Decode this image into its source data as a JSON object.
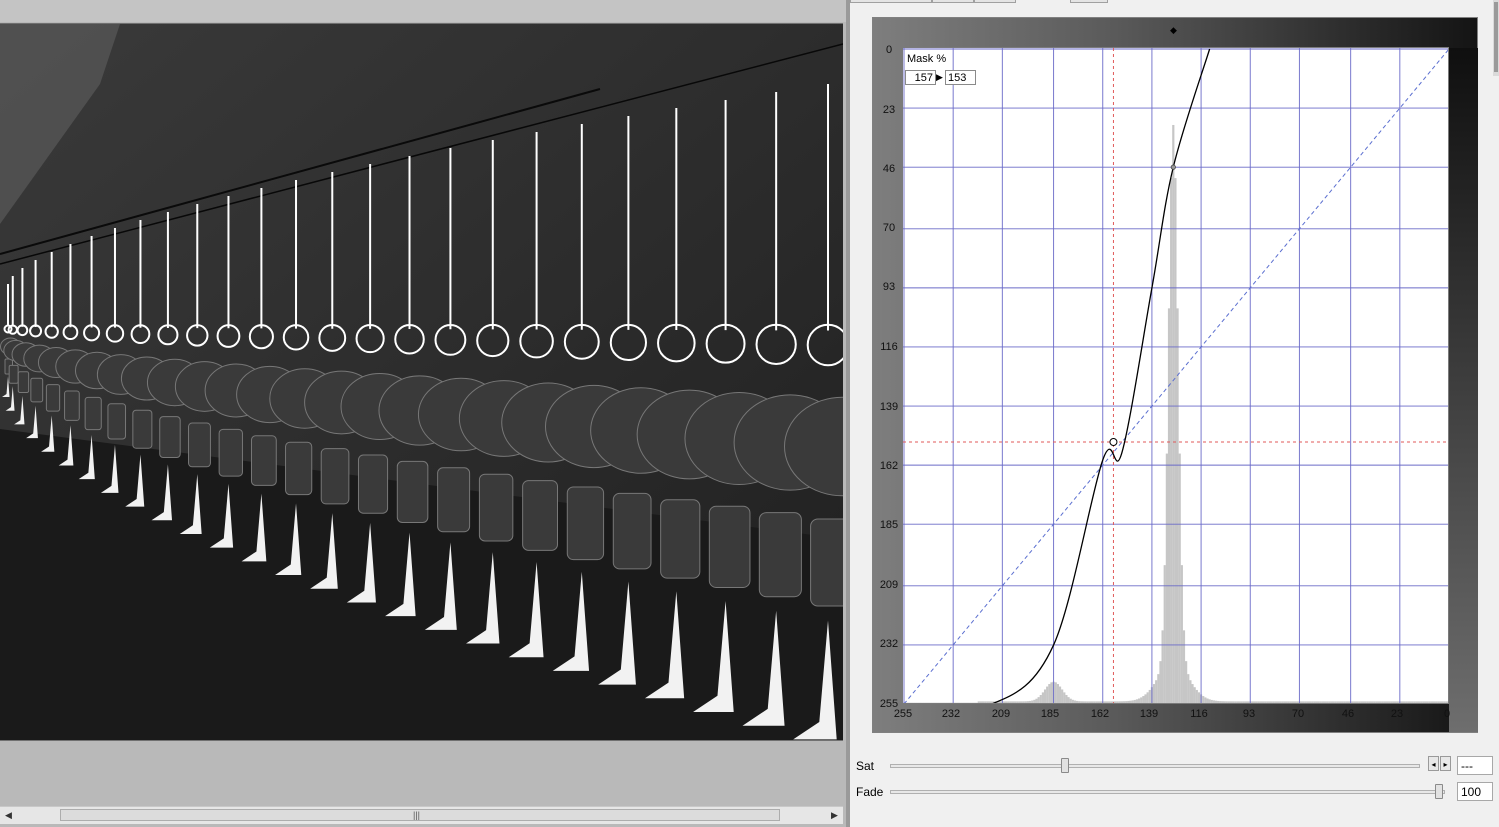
{
  "curves_panel": {
    "mask_label": "Mask %",
    "mask_input": "157",
    "mask_output": "153",
    "y_ticks": [
      "0",
      "23",
      "46",
      "70",
      "93",
      "116",
      "139",
      "162",
      "185",
      "209",
      "232",
      "255"
    ],
    "x_ticks": [
      "255",
      "232",
      "209",
      "185",
      "162",
      "139",
      "116",
      "93",
      "70",
      "46",
      "23",
      "0"
    ],
    "curve_points": [
      [
        255,
        255
      ],
      [
        214,
        255
      ],
      [
        185,
        232
      ],
      [
        162,
        160
      ],
      [
        153,
        157
      ],
      [
        139,
        93
      ],
      [
        129,
        46
      ],
      [
        112,
        0
      ]
    ],
    "histogram_peaks": [
      {
        "level": 185,
        "height": 0.03
      },
      {
        "level": 129,
        "height": 0.82
      }
    ]
  },
  "sat": {
    "label": "Sat",
    "value": "---",
    "level": 0.33
  },
  "fade": {
    "label": "Fade",
    "value": "100",
    "level": 1.0
  },
  "colors": {
    "grid": "#6a6ac8",
    "guide": "#e05a5a",
    "diagonal": "#5b6fd0",
    "histogram": "#c6c6c6"
  }
}
